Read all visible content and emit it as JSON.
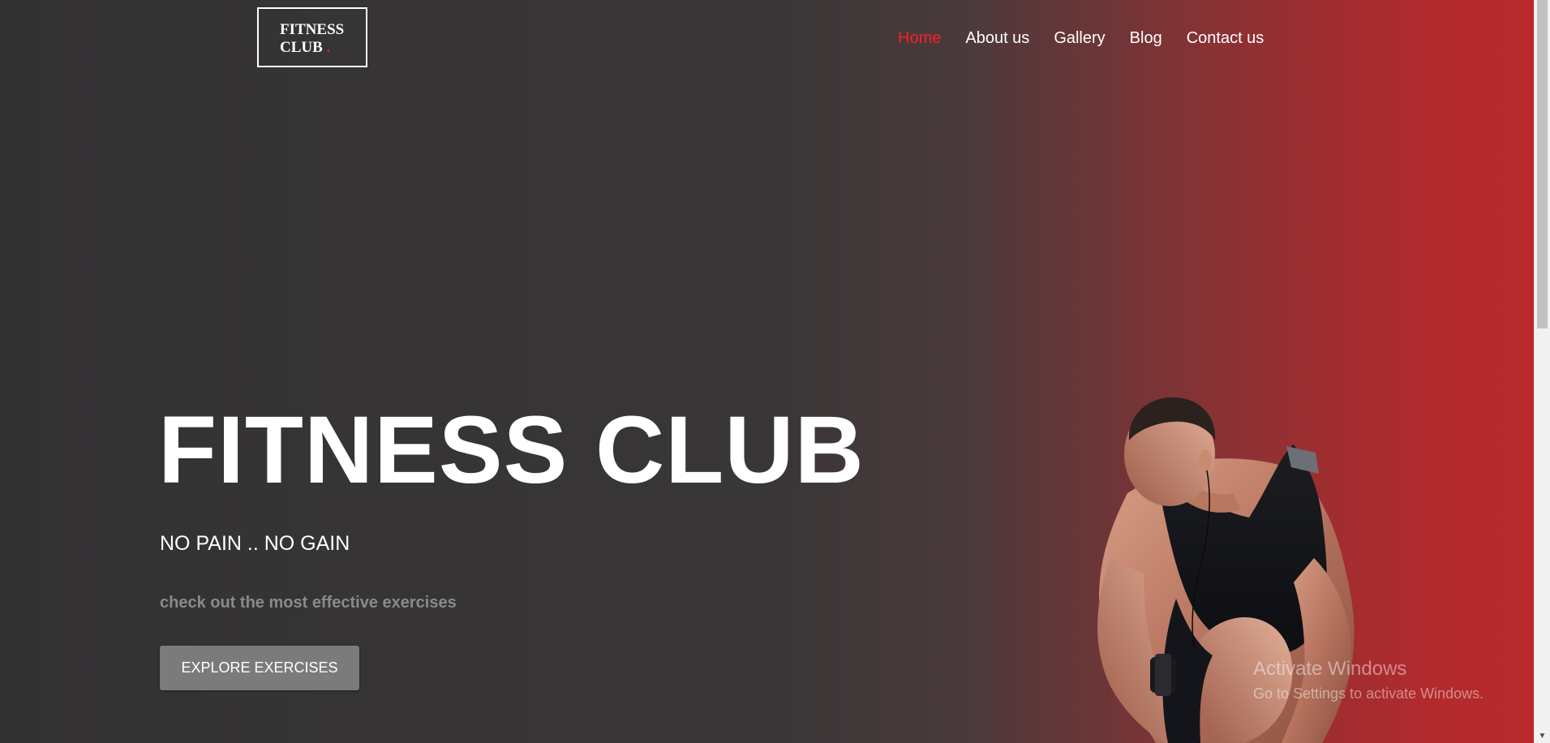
{
  "logo": {
    "line1": "FITNESS",
    "line2": "CLUB",
    "dot": "."
  },
  "nav": {
    "items": [
      {
        "label": "Home",
        "active": true
      },
      {
        "label": "About us"
      },
      {
        "label": "Gallery"
      },
      {
        "label": "Blog"
      },
      {
        "label": "Contact us"
      }
    ]
  },
  "hero": {
    "title": "FITNESS CLUB",
    "subtitle": "NO PAIN .. NO GAIN",
    "description": "check out the most effective exercises",
    "cta_label": "EXPLORE EXERCISES"
  },
  "watermark": {
    "line1": "Activate Windows",
    "line2": "Go to Settings to activate Windows."
  },
  "colors": {
    "accent": "#ff1e1e",
    "gradient_start": "#333233",
    "gradient_end": "#b8292c",
    "button_bg": "#7b7b7b"
  },
  "icons": {
    "scroll_down": "chevron-down-icon"
  }
}
